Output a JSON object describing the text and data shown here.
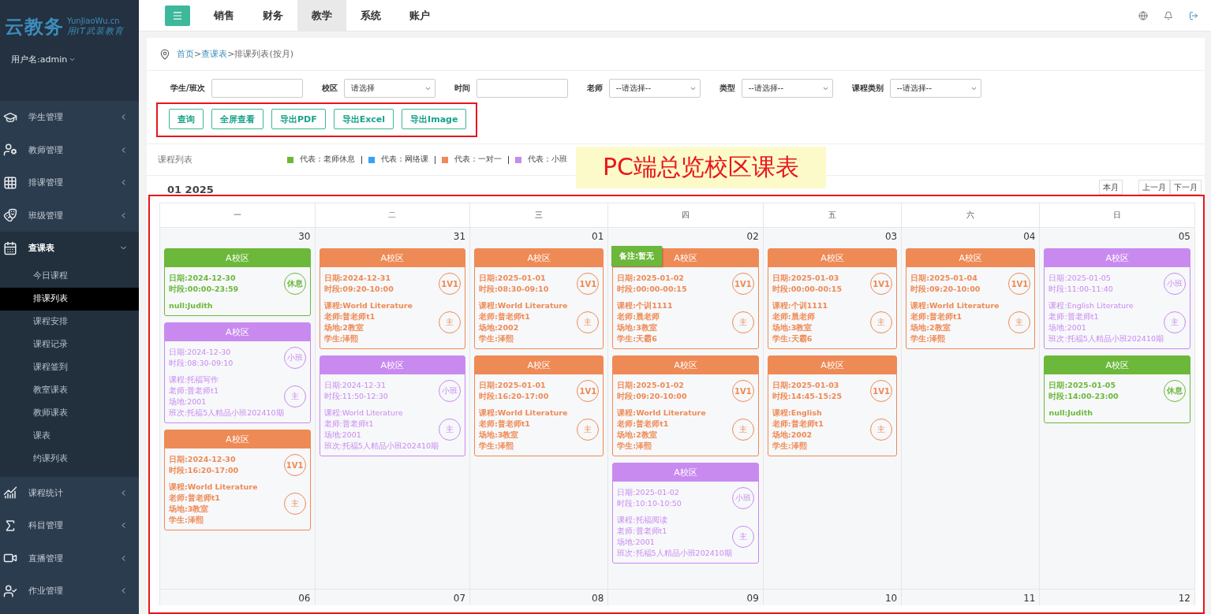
{
  "sidebar": {
    "logo": "云教务",
    "logo_domain": "YunJiaoWu.cn",
    "logo_slogan": "用IT武装教育",
    "user": "用户名:admin",
    "items": [
      {
        "label": "学生管理",
        "expanded": false
      },
      {
        "label": "教师管理",
        "expanded": false
      },
      {
        "label": "排课管理",
        "expanded": false
      },
      {
        "label": "班级管理",
        "expanded": false
      },
      {
        "label": "查课表",
        "expanded": true,
        "children": [
          {
            "label": "今日课程",
            "selected": false
          },
          {
            "label": "排课列表",
            "selected": true
          },
          {
            "label": "课程安排",
            "selected": false
          },
          {
            "label": "课程记录",
            "selected": false
          },
          {
            "label": "课程签到",
            "selected": false
          },
          {
            "label": "教室课表",
            "selected": false
          },
          {
            "label": "教师课表",
            "selected": false
          },
          {
            "label": "课表",
            "selected": false
          },
          {
            "label": "约课列表",
            "selected": false
          }
        ]
      },
      {
        "label": "课程统计",
        "expanded": false
      },
      {
        "label": "科目管理",
        "expanded": false
      },
      {
        "label": "直播管理",
        "expanded": false
      },
      {
        "label": "作业管理",
        "expanded": false
      }
    ]
  },
  "top_nav": {
    "tabs": [
      {
        "label": "销售",
        "selected": false
      },
      {
        "label": "财务",
        "selected": false
      },
      {
        "label": "教学",
        "selected": true
      },
      {
        "label": "系统",
        "selected": false
      },
      {
        "label": "账户",
        "selected": false
      }
    ]
  },
  "breadcrumb": {
    "links": [
      "首页",
      "查课表"
    ],
    "separator": ">",
    "current": "排课列表(按月)"
  },
  "filters": [
    {
      "kind": "input",
      "label": "学生/班次"
    },
    {
      "kind": "select",
      "label": "校区",
      "value": "请选择"
    },
    {
      "kind": "input",
      "label": "时间"
    },
    {
      "kind": "select",
      "label": "老师",
      "value": "--请选择--"
    },
    {
      "kind": "select",
      "label": "类型",
      "value": "--请选择--"
    },
    {
      "kind": "select",
      "label": "课程类别",
      "value": "--请选择--"
    }
  ],
  "buttons": [
    "查询",
    "全屏查看",
    "导出PDF",
    "导出Excel",
    "导出Image"
  ],
  "callout": "PC端总览校区课表",
  "list_title": "课程列表",
  "legend": [
    {
      "label": "代表：老师休息",
      "color": "#6bb83a"
    },
    {
      "label": "代表：网络课",
      "color": "#3aa0f0"
    },
    {
      "label": "代表：一对一",
      "color": "#ee8a55"
    },
    {
      "label": "代表：小班",
      "color": "#c98af0"
    }
  ],
  "calendar": {
    "month": "01 2025",
    "today_button": "本月",
    "prev_button": "上一月",
    "next_button": "下一月",
    "weekdays": [
      "一",
      "二",
      "三",
      "四",
      "五",
      "六",
      "日"
    ],
    "days": [
      {
        "day": "30",
        "events": [
          {
            "kind": "rest",
            "campus": "A校区",
            "date": "日期:2024-12-30",
            "time": "时段:00:00-23:59",
            "badge": "休息",
            "details": [
              "null:Judith"
            ]
          },
          {
            "kind": "small",
            "campus": "A校区",
            "date": "日期:2024-12-30",
            "time": "时段:08:30-09:10",
            "badge": "小班",
            "role": "主",
            "details": [
              "课程:托福写作",
              "老师:普老师t1",
              "场地:2001",
              "班次:托福5人精品小班202410期"
            ]
          },
          {
            "kind": "one",
            "campus": "A校区",
            "date": "日期:2024-12-30",
            "time": "时段:16:20-17:00",
            "badge": "1V1",
            "role": "主",
            "details": [
              "课程:World Literature",
              "老师:普老师t1",
              "场地:3教室",
              "学生:泽熙"
            ]
          }
        ]
      },
      {
        "day": "31",
        "events": [
          {
            "kind": "one",
            "campus": "A校区",
            "date": "日期:2024-12-31",
            "time": "时段:09:20-10:00",
            "badge": "1V1",
            "role": "主",
            "details": [
              "课程:World Literature",
              "老师:普老师t1",
              "场地:2教室",
              "学生:泽熙"
            ]
          },
          {
            "kind": "small",
            "campus": "A校区",
            "date": "日期:2024-12-31",
            "time": "时段:11:50-12:30",
            "badge": "小班",
            "role": "主",
            "details": [
              "课程:World Literature",
              "老师:普老师t1",
              "场地:2001",
              "班次:托福5人精品小班202410期"
            ]
          }
        ]
      },
      {
        "day": "01",
        "events": [
          {
            "kind": "one",
            "campus": "A校区",
            "date": "日期:2025-01-01",
            "time": "时段:08:30-09:10",
            "badge": "1V1",
            "role": "主",
            "details": [
              "课程:World Literature",
              "老师:普老师t1",
              "场地:2002",
              "学生:泽熙"
            ]
          },
          {
            "kind": "one",
            "campus": "A校区",
            "date": "日期:2025-01-01",
            "time": "时段:16:20-17:00",
            "badge": "1V1",
            "role": "主",
            "details": [
              "课程:World Literature",
              "老师:普老师t1",
              "场地:3教室",
              "学生:泽熙"
            ]
          }
        ]
      },
      {
        "day": "02",
        "events": [
          {
            "kind": "one",
            "campus": "A校区",
            "tooltip": "备注:暂无",
            "date": "日期:2025-01-02",
            "time": "时段:00:00-00:15",
            "badge": "1V1",
            "role": "主",
            "details": [
              "课程:个训1111",
              "老师:晨老师",
              "场地:3教室",
              "学生:天霸6"
            ]
          },
          {
            "kind": "one",
            "campus": "A校区",
            "date": "日期:2025-01-02",
            "time": "时段:09:20-10:00",
            "badge": "1V1",
            "role": "主",
            "details": [
              "课程:World Literature",
              "老师:普老师t1",
              "场地:2教室",
              "学生:泽熙"
            ]
          },
          {
            "kind": "small",
            "campus": "A校区",
            "date": "日期:2025-01-02",
            "time": "时段:10:10-10:50",
            "badge": "小班",
            "role": "主",
            "details": [
              "课程:托福阅读",
              "老师:普老师t1",
              "场地:2001",
              "班次:托福5人精品小班202410期"
            ]
          }
        ]
      },
      {
        "day": "03",
        "events": [
          {
            "kind": "one",
            "campus": "A校区",
            "date": "日期:2025-01-03",
            "time": "时段:00:00-00:15",
            "badge": "1V1",
            "role": "主",
            "details": [
              "课程:个训1111",
              "老师:晨老师",
              "场地:3教室",
              "学生:天霸6"
            ]
          },
          {
            "kind": "one",
            "campus": "A校区",
            "date": "日期:2025-01-03",
            "time": "时段:14:45-15:25",
            "badge": "1V1",
            "role": "主",
            "details": [
              "课程:English",
              "老师:普老师t1",
              "场地:2002",
              "学生:泽熙"
            ]
          }
        ]
      },
      {
        "day": "04",
        "events": [
          {
            "kind": "one",
            "campus": "A校区",
            "date": "日期:2025-01-04",
            "time": "时段:09:20-10:00",
            "badge": "1V1",
            "role": "主",
            "details": [
              "课程:World Literature",
              "老师:普老师t1",
              "场地:2教室",
              "学生:泽熙"
            ]
          }
        ]
      },
      {
        "day": "05",
        "events": [
          {
            "kind": "small",
            "campus": "A校区",
            "date": "日期:2025-01-05",
            "time": "时段:11:00-11:40",
            "badge": "小班",
            "role": "主",
            "details": [
              "课程:English Literature",
              "老师:普老师t1",
              "场地:2001",
              "班次:托福5人精品小班202410期"
            ]
          },
          {
            "kind": "rest",
            "campus": "A校区",
            "date": "日期:2025-01-05",
            "time": "时段:14:00-23:00",
            "badge": "休息",
            "details": [
              "null:Judith"
            ]
          }
        ]
      }
    ],
    "next_week_days": [
      "06",
      "07",
      "08",
      "09",
      "10",
      "11",
      "12"
    ]
  }
}
